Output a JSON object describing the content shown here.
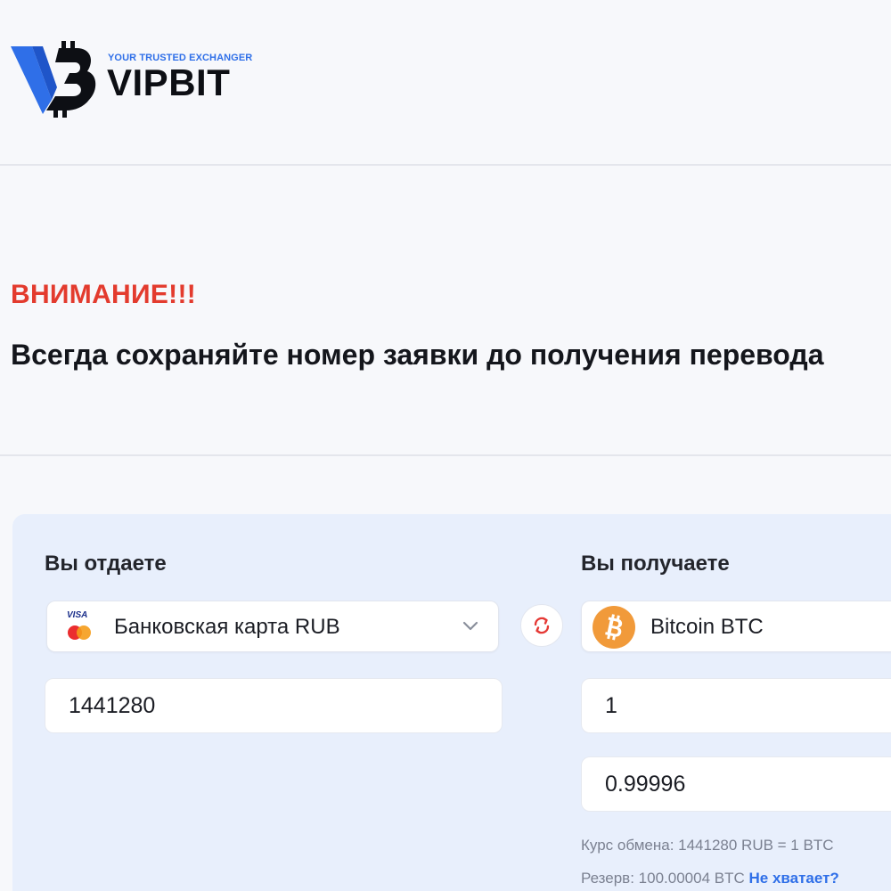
{
  "header": {
    "logo": {
      "tagline": "YOUR TRUSTED EXCHANGER",
      "name": "VIPBIT",
      "brand_color": "#2f6fe8"
    }
  },
  "notice": {
    "title": "ВНИМАНИЕ!!!",
    "text": "Всегда сохраняйте номер заявки до получения перевода",
    "title_color": "#e33b2e"
  },
  "exchange": {
    "give": {
      "label": "Вы отдаете",
      "currency": "Банковская карта RUB",
      "card_brand": "VISA",
      "icon": "visa-mastercard-icon",
      "amount": "1441280"
    },
    "swap_icon": "swap-arrows-icon",
    "receive": {
      "label": "Вы получаете",
      "currency": "Bitcoin BTC",
      "icon": "bitcoin-icon",
      "amount": "1",
      "amount_net": "0.99996"
    },
    "rate": {
      "label": "Курс обмена: 1441280 RUB = 1 BTC"
    },
    "reserve": {
      "label": "Резерв: 100.00004 BTC",
      "link": "Не хватает?"
    }
  }
}
